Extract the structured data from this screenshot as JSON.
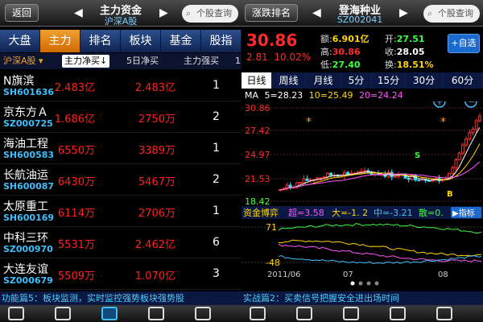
{
  "left": {
    "back_label": "返回",
    "title": "主力资金",
    "subtitle": "沪深A股",
    "search_placeholder": "个股查询",
    "tabs": [
      "大盘",
      "主力",
      "排名",
      "板块",
      "基金",
      "股指"
    ],
    "active_tab": "主力",
    "subheader": {
      "market": "沪深A股",
      "col1": "主力净买↓",
      "col2": "5日净买",
      "col3": "主力强买",
      "col4": "1"
    },
    "rows": [
      {
        "name": "N旗滨",
        "code": "SH601636",
        "net_buy": "2.483亿",
        "net_buy_5d": "2.483亿",
        "rank": "1"
      },
      {
        "name": "京东方Ａ",
        "code": "SZ000725",
        "net_buy": "1.686亿",
        "net_buy_5d": "2750万",
        "rank": "2"
      },
      {
        "name": "海油工程",
        "code": "SH600583",
        "net_buy": "6550万",
        "net_buy_5d": "3389万",
        "rank": "1"
      },
      {
        "name": "长航油运",
        "code": "SH600087",
        "net_buy": "6430万",
        "net_buy_5d": "5467万",
        "rank": "2"
      },
      {
        "name": "太原重工",
        "code": "SH600169",
        "net_buy": "6114万",
        "net_buy_5d": "2706万",
        "rank": "1"
      },
      {
        "name": "中科三环",
        "code": "SZ000970",
        "net_buy": "5531万",
        "net_buy_5d": "2.462亿",
        "rank": "6"
      },
      {
        "name": "大连友谊",
        "code": "SZ000679",
        "net_buy": "5509万",
        "net_buy_5d": "1.070亿",
        "rank": "3"
      }
    ]
  },
  "right": {
    "prev_label": "涨跌排名",
    "title": "登海种业",
    "code": "SZ002041",
    "search_placeholder": "个股查询",
    "price": "30.86",
    "change": "2.81",
    "change_pct": "10.02%",
    "quote": [
      {
        "label": "额:",
        "value": "6.901亿",
        "color": "#ffd700"
      },
      {
        "label": "开:",
        "value": "27.51",
        "color": "#3cff3c"
      },
      {
        "label": "高:",
        "value": "30.86",
        "color": "#ff2b2b"
      },
      {
        "label": "收:",
        "value": "28.05",
        "color": "#ffffff"
      },
      {
        "label": "低:",
        "value": "27.40",
        "color": "#3cff3c"
      },
      {
        "label": "换:",
        "value": "18.51%",
        "color": "#ffd700"
      }
    ],
    "add_label": "+自选",
    "period_tabs": [
      "日线",
      "周线",
      "月线",
      "5分",
      "15分",
      "30分",
      "60分"
    ],
    "active_period": "日线",
    "ma": {
      "prefix": "MA",
      "ma5": "5=28.23",
      "ma10": "10=25.49",
      "ma20": "20=24.24"
    },
    "price_axis": [
      "30.86",
      "27.42",
      "24.97",
      "21.53",
      "18.42"
    ],
    "capital_flow": {
      "label": "资金博弈",
      "super": "超=3.58",
      "big": "大=-1. 2",
      "mid": "中=-3.21",
      "retail": "散=0.",
      "indicator_label": "▶指标",
      "axis": [
        "71",
        "-48"
      ]
    },
    "time_axis": [
      "2011/06",
      "07",
      "08"
    ],
    "markers": {
      "s": "S",
      "b": "B"
    }
  },
  "ticker": {
    "left": "功能篇5：板块监测，实时监控强势板块强势股",
    "right": "实战篇2：买卖信号把握安全进出场时间"
  },
  "colors": {
    "up": "#ff2b2b",
    "down": "#3cff3c",
    "accent": "#f0a030",
    "code": "#3ec0ff",
    "ma5": "#ffffff",
    "ma10": "#ffd700",
    "ma20": "#ff55ff"
  },
  "nav_icons": [
    "home-icon",
    "list-icon",
    "capital-flow-icon",
    "news-icon",
    "refresh-icon",
    "settings-icon",
    "portfolio-icon",
    "quote-icon",
    "cards-icon",
    "tools-icon"
  ]
}
